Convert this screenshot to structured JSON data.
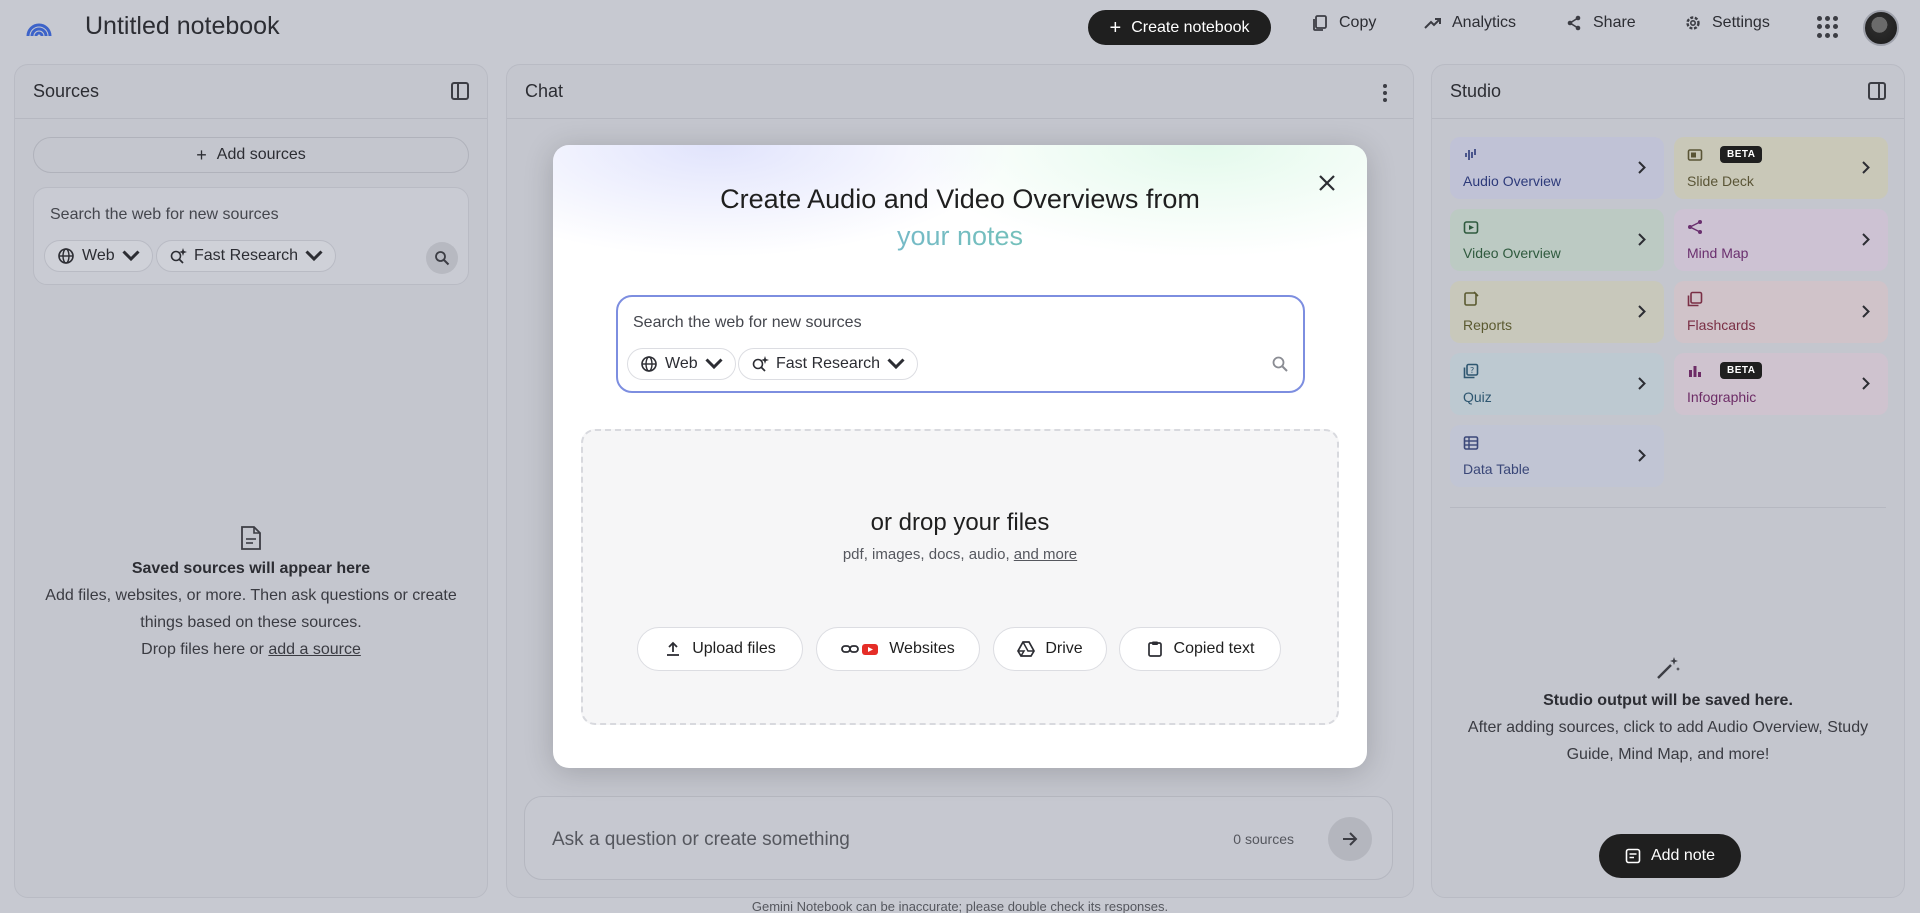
{
  "header": {
    "title": "Untitled notebook",
    "create_label": "Create notebook",
    "copy_label": "Copy",
    "analytics_label": "Analytics",
    "share_label": "Share",
    "settings_label": "Settings"
  },
  "sources": {
    "title": "Sources",
    "add_label": "Add sources",
    "search_placeholder": "Search the web for new sources",
    "web_label": "Web",
    "research_label": "Fast Research",
    "empty_title": "Saved sources will appear here",
    "empty_line1": "Add files, websites, or more. Then ask questions or create",
    "empty_line2": "things based on these sources.",
    "empty_line3_prefix": "Drop files here or ",
    "empty_link": "add a source"
  },
  "chat": {
    "title": "Chat",
    "input_placeholder": "Ask a question or create something",
    "source_count": "0 sources",
    "disclaimer": "Gemini Notebook can be inaccurate; please double check its responses."
  },
  "studio": {
    "title": "Studio",
    "tiles": [
      {
        "label": "Audio Overview",
        "bg": "#c0c2d6",
        "fg": "#2d3a7a"
      },
      {
        "label": "Slide Deck",
        "bg": "#c9c8b8",
        "fg": "#5a5536",
        "badge": "BETA"
      },
      {
        "label": "Video Overview",
        "bg": "#bccac3",
        "fg": "#2f5a3e"
      },
      {
        "label": "Mind Map",
        "bg": "#cdc2d3",
        "fg": "#6a2f6e"
      },
      {
        "label": "Reports",
        "bg": "#c8c8bb",
        "fg": "#5b5a30"
      },
      {
        "label": "Flashcards",
        "bg": "#d0c3c9",
        "fg": "#7a2f45"
      },
      {
        "label": "Quiz",
        "bg": "#bdc9d1",
        "fg": "#2e5670"
      },
      {
        "label": "Infographic",
        "bg": "#cfc3cf",
        "fg": "#6d2c66",
        "badge": "BETA"
      },
      {
        "label": "Data Table",
        "bg": "#c1c5d4",
        "fg": "#3a4778"
      }
    ],
    "empty_title": "Studio output will be saved here.",
    "empty_line1": "After adding sources, click to add Audio Overview, Study",
    "empty_line2": "Guide, Mind Map, and more!",
    "add_note_label": "Add note"
  },
  "modal": {
    "title_line1": "Create Audio and Video Overviews from",
    "title_line2": "your notes",
    "search_placeholder": "Search the web for new sources",
    "web_label": "Web",
    "research_label": "Fast Research",
    "drop_title": "or drop your files",
    "drop_sub_prefix": "pdf, images, docs, audio, ",
    "drop_sub_link": "and more",
    "buttons": {
      "upload": "Upload files",
      "websites": "Websites",
      "drive": "Drive",
      "copied": "Copied text"
    }
  }
}
